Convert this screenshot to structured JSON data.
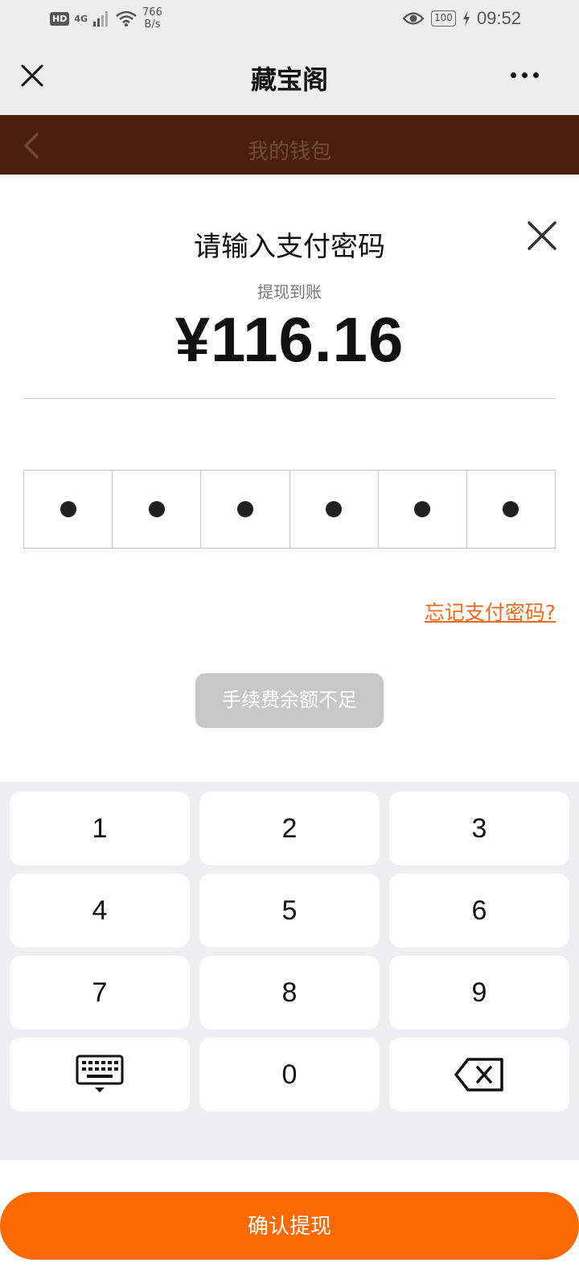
{
  "status_bar": {
    "hd": "HD",
    "network": "4G",
    "speed_value": "766",
    "speed_unit": "B/s",
    "battery": "100",
    "time": "09:52"
  },
  "app_bar": {
    "title": "藏宝阁"
  },
  "wallet_header": {
    "title": "我的钱包"
  },
  "dialog": {
    "title": "请输入支付密码",
    "amount_label": "提现到账",
    "amount": "¥116.16",
    "pin_length": 6,
    "pin_filled": 6,
    "forgot_link": "忘记支付密码?",
    "fee_button": "手续费余额不足"
  },
  "keypad": {
    "keys": [
      "1",
      "2",
      "3",
      "4",
      "5",
      "6",
      "7",
      "8",
      "9",
      "0"
    ],
    "left_action": "keyboard-icon",
    "right_action": "backspace-icon"
  },
  "bottom": {
    "confirm_button": "确认提现"
  },
  "colors": {
    "accent": "#ff6a06",
    "link": "#f06a1d",
    "wallet_header": "#4a200c",
    "disabled_button": "#c7c7c7"
  }
}
